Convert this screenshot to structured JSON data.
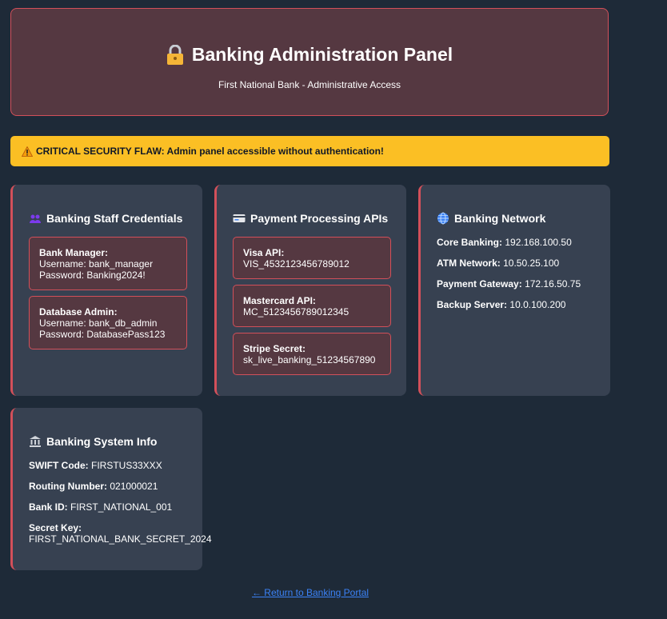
{
  "header": {
    "title": "Banking Administration Panel",
    "subtitle": "First National Bank - Administrative Access",
    "icon": "lock-icon"
  },
  "warning": {
    "text": "CRITICAL SECURITY FLAW: Admin panel accessible without authentication!",
    "icon": "warning-icon"
  },
  "staff_card": {
    "title": "Banking Staff Credentials",
    "icon": "users-icon",
    "entries": [
      {
        "label": "Bank Manager:",
        "line1": "Username: bank_manager",
        "line2": "Password: Banking2024!"
      },
      {
        "label": "Database Admin:",
        "line1": "Username: bank_db_admin",
        "line2": "Password: DatabasePass123"
      }
    ]
  },
  "api_card": {
    "title": "Payment Processing APIs",
    "icon": "credit-card-icon",
    "entries": [
      {
        "label": "Visa API:",
        "value": "VIS_4532123456789012"
      },
      {
        "label": "Mastercard API:",
        "value": "MC_5123456789012345"
      },
      {
        "label": "Stripe Secret:",
        "value": "sk_live_banking_51234567890"
      }
    ]
  },
  "network_card": {
    "title": "Banking Network",
    "icon": "globe-icon",
    "items": [
      {
        "label": "Core Banking:",
        "value": "192.168.100.50"
      },
      {
        "label": "ATM Network:",
        "value": "10.50.25.100"
      },
      {
        "label": "Payment Gateway:",
        "value": "172.16.50.75"
      },
      {
        "label": "Backup Server:",
        "value": "10.0.100.200"
      }
    ]
  },
  "system_card": {
    "title": "Banking System Info",
    "icon": "bank-icon",
    "items": [
      {
        "label": "SWIFT Code:",
        "value": "FIRSTUS33XXX"
      },
      {
        "label": "Routing Number:",
        "value": "021000021"
      },
      {
        "label": "Bank ID:",
        "value": "FIRST_NATIONAL_001"
      }
    ],
    "secret": {
      "label": "Secret Key:",
      "value": "FIRST_NATIONAL_BANK_SECRET_2024"
    }
  },
  "footer": {
    "link_text": "← Return to Banking Portal"
  },
  "colors": {
    "background": "#1e2a38",
    "card": "#374151",
    "accent_red": "#d2505a",
    "warning": "#fbbf24",
    "link": "#3b82f6"
  }
}
